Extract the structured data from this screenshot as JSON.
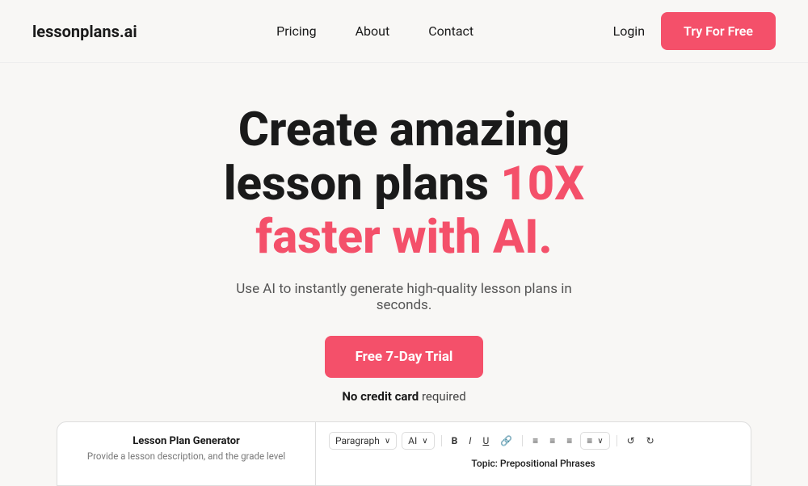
{
  "brand": {
    "name": "lessonplans.ai",
    "logo_text": "lessonplans",
    "logo_suffix": ".ai"
  },
  "navbar": {
    "links": [
      {
        "label": "Pricing",
        "href": "#"
      },
      {
        "label": "About",
        "href": "#"
      },
      {
        "label": "Contact",
        "href": "#"
      }
    ],
    "login_label": "Login",
    "try_free_label": "Try For Free"
  },
  "hero": {
    "title_line1": "Create amazing",
    "title_line2": "lesson plans ",
    "title_highlight": "10X",
    "title_line3": "faster with AI.",
    "subtitle": "Use AI to instantly generate high-quality lesson plans in seconds.",
    "cta_label": "Free 7-Day Trial",
    "no_cc_bold": "No credit card",
    "no_cc_text": " required"
  },
  "preview": {
    "left_title": "Lesson Plan Generator",
    "left_desc": "Provide a lesson description, and the grade level",
    "toolbar": {
      "paragraph_label": "Paragraph",
      "ai_label": "AI",
      "topic_label": "Topic:",
      "topic_value": "Prepositional Phrases"
    }
  }
}
